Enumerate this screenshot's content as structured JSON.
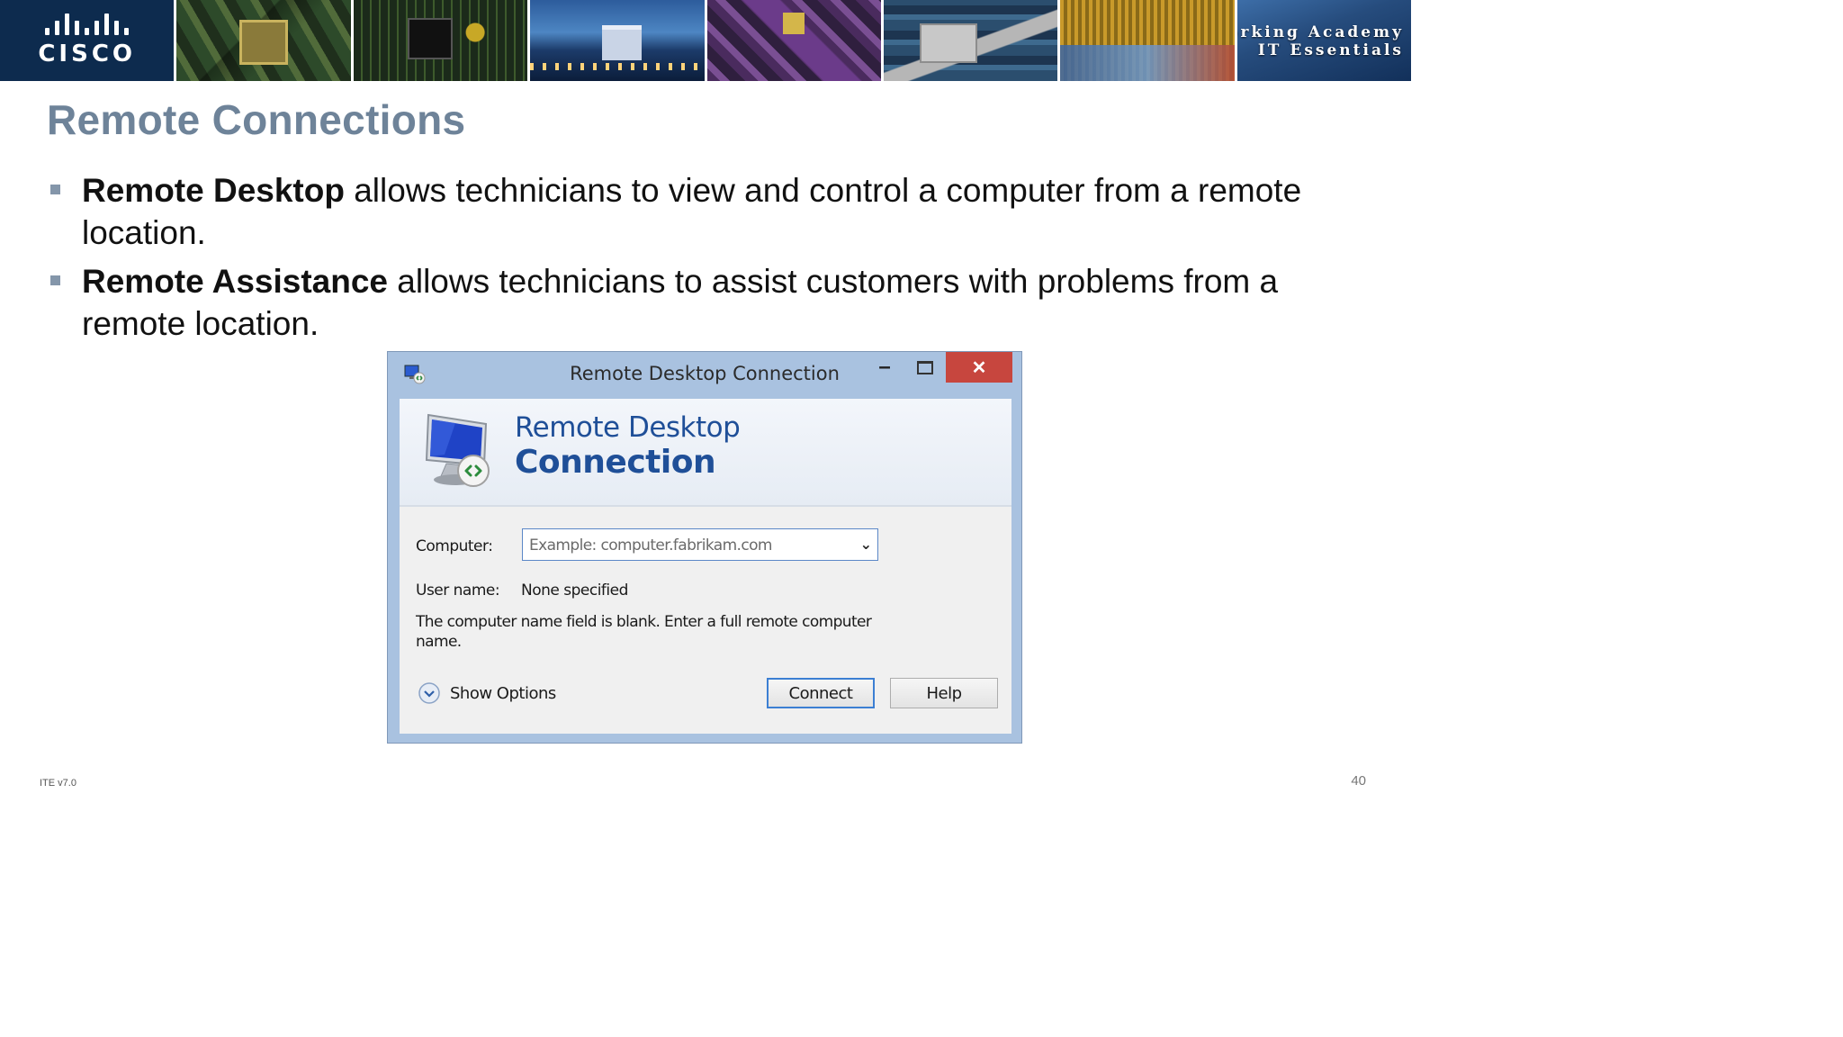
{
  "banner": {
    "logo_text": "CISCO",
    "academy_line1": "Cisco Networking Academy",
    "academy_line2": "IT Essentials"
  },
  "slide": {
    "title": "Remote Connections",
    "bullets": [
      {
        "bold": "Remote Desktop",
        "text": " allows technicians to view and control a computer from a remote location."
      },
      {
        "bold": "Remote Assistance",
        "text": " allows technicians to assist customers with problems from a remote location."
      }
    ]
  },
  "dialog": {
    "window_title": "Remote Desktop Connection",
    "minimize_glyph": "–",
    "close_glyph": "✕",
    "header_line1": "Remote Desktop",
    "header_line2": "Connection",
    "computer_label": "Computer:",
    "computer_placeholder": "Example: computer.fabrikam.com",
    "combo_arrow": "⌄",
    "username_label": "User name:",
    "username_value": "None specified",
    "message": "The computer name field is blank. Enter a full remote computer name.",
    "show_options_label": "Show Options",
    "connect_label": "Connect",
    "help_label": "Help"
  },
  "footer": {
    "left": "ITE v7.0",
    "page_number": "40"
  },
  "colors": {
    "title": "#6e8399",
    "bullet_marker": "#8496aa",
    "dialog_frame": "#a9c2e0",
    "close_button": "#c7463e",
    "header_text": "#1f4f98",
    "focus_border": "#3c7fd3"
  },
  "icons": [
    "cisco-logo",
    "remote-desktop-app-icon",
    "remote-desktop-monitor-icon",
    "minimize-icon",
    "maximize-icon",
    "close-icon",
    "dropdown-chevron-icon",
    "expand-chevron-icon"
  ]
}
